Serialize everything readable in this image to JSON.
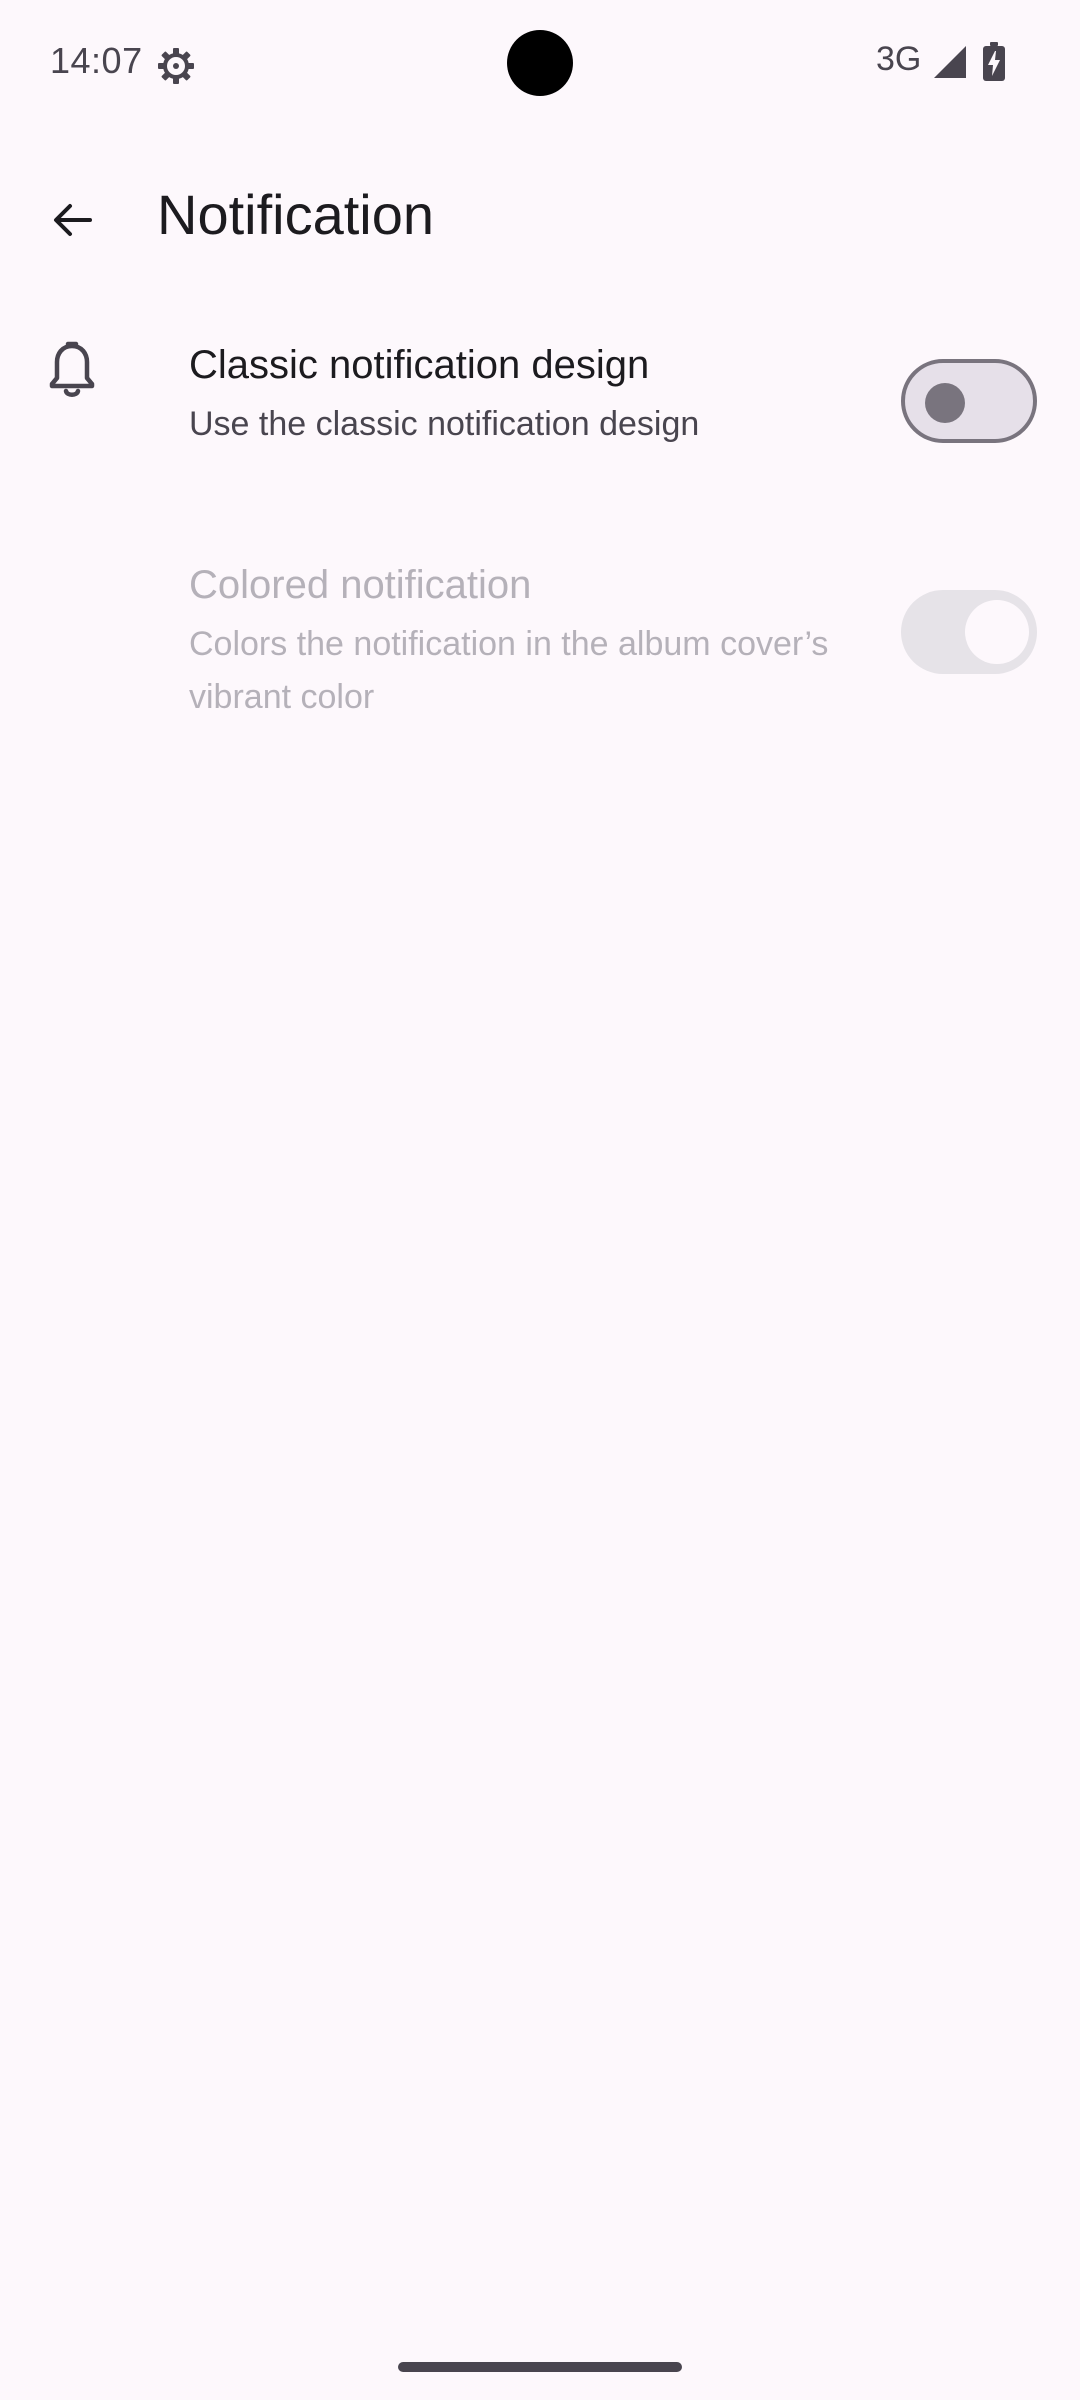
{
  "status_bar": {
    "time": "14:07",
    "network": "3G",
    "icons": [
      "gear-icon",
      "signal-icon",
      "battery-charging-icon"
    ]
  },
  "app_bar": {
    "title": "Notification",
    "back_icon": "arrow-back-icon"
  },
  "settings": [
    {
      "title": "Classic notification design",
      "summary": "Use the classic notification design",
      "icon": "bell-icon",
      "enabled": true,
      "checked": false
    },
    {
      "title": "Colored notification",
      "summary": "Colors the notification in the album cover’s vibrant color",
      "enabled": false,
      "checked": true
    }
  ],
  "colors": {
    "background": "#fdf8fc",
    "on_surface": "#1c1b1f",
    "on_surface_variant": "#49454f",
    "outline": "#79747e",
    "disabled_text": "#b5b1b9"
  }
}
